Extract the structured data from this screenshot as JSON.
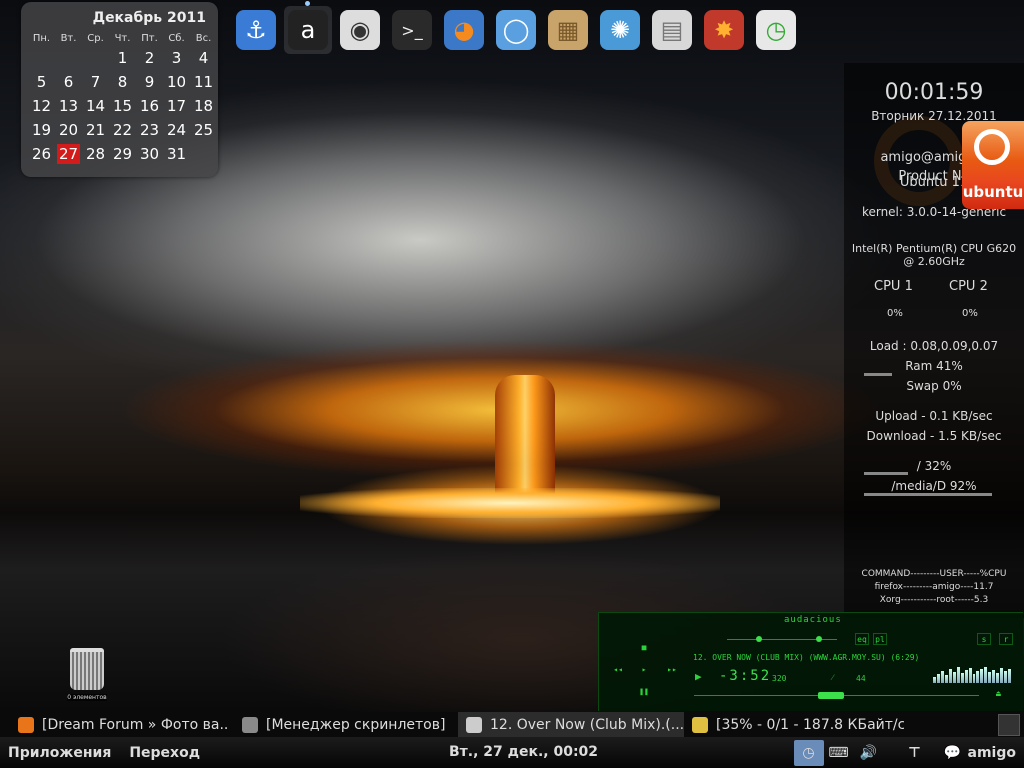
{
  "calendar": {
    "title": "Декабрь 2011",
    "weekdays": [
      "Пн.",
      "Вт.",
      "Ср.",
      "Чт.",
      "Пт.",
      "Сб.",
      "Вс."
    ],
    "weeks": [
      [
        "",
        "",
        "",
        "1",
        "2",
        "3",
        "4"
      ],
      [
        "5",
        "6",
        "7",
        "8",
        "9",
        "10",
        "11"
      ],
      [
        "12",
        "13",
        "14",
        "15",
        "16",
        "17",
        "18"
      ],
      [
        "19",
        "20",
        "21",
        "22",
        "23",
        "24",
        "25"
      ],
      [
        "26",
        "27",
        "28",
        "29",
        "30",
        "31",
        ""
      ]
    ],
    "today": "27",
    "today_color": "#d31b1b"
  },
  "dock": {
    "items": [
      {
        "name": "anchor-icon",
        "glyph": "⚓",
        "bg": "#3a7bd5",
        "fg": "#fff"
      },
      {
        "name": "avant-icon",
        "glyph": "a",
        "bg": "#222",
        "fg": "#fff",
        "active": true
      },
      {
        "name": "camera-icon",
        "glyph": "◉",
        "bg": "#ddd",
        "fg": "#333"
      },
      {
        "name": "terminal-icon",
        "glyph": ">_",
        "bg": "#2a2a2a",
        "fg": "#eee"
      },
      {
        "name": "firefox-icon",
        "glyph": "◕",
        "bg": "#3b78c8",
        "fg": "#f58a1f"
      },
      {
        "name": "chromium-icon",
        "glyph": "◯",
        "bg": "#5aa0e0",
        "fg": "#fff"
      },
      {
        "name": "package-icon",
        "glyph": "▦",
        "bg": "#c9a46a",
        "fg": "#7a5a2a"
      },
      {
        "name": "shutter-icon",
        "glyph": "✺",
        "bg": "#4a9ad8",
        "fg": "#fff"
      },
      {
        "name": "file-cabinet-icon",
        "glyph": "▤",
        "bg": "#d8d8d8",
        "fg": "#777"
      },
      {
        "name": "burner-icon",
        "glyph": "✸",
        "bg": "#c0392b",
        "fg": "#ffb030"
      },
      {
        "name": "screenlets-manager-icon",
        "glyph": "◷",
        "bg": "#e8e8e8",
        "fg": "#3a3"
      }
    ]
  },
  "sysinfo": {
    "time": "00:01:59",
    "date": "Вторник 27.12.2011",
    "user": "amigo@amigo-S",
    "product": "Product Na",
    "os": "Ubuntu 11",
    "kernel": "kernel: 3.0.0-14-generic",
    "cpu_model": "Intel(R) Pentium(R) CPU G620 @ 2.60GHz",
    "cpu1_label": "CPU 1",
    "cpu2_label": "CPU 2",
    "cpu1_value": "0%",
    "cpu2_value": "0%",
    "load": "Load : 0.08,0.09,0.07",
    "ram": "Ram 41%",
    "swap": "Swap 0%",
    "upload": "Upload - 0.1 KB/sec",
    "download": "Download - 1.5 KB/sec",
    "disk_root": "/ 32%",
    "disk_media": "/media/D 92%",
    "ubuntu_badge": "ubuntu",
    "processes_header": "COMMAND---------USER-----%CPU",
    "processes": [
      "firefox---------amigo----11.7",
      "Xorg-----------root------5.3"
    ]
  },
  "player": {
    "logo": "audacious",
    "track": "12. OVER NOW (CLUB MIX) (WWW.AGR.MOY.SU) (6:29)",
    "time": "-3:52",
    "kbps": "320",
    "khz": "44",
    "spectrum": [
      6,
      9,
      12,
      8,
      14,
      11,
      16,
      10,
      13,
      15,
      9,
      12,
      14,
      16,
      11,
      13,
      10,
      15,
      12,
      14
    ],
    "accent": "#2bd33a"
  },
  "trash": {
    "label": "0 элементов"
  },
  "taskbar": {
    "tasks": [
      {
        "label": "[Dream Forum » Фото ва...",
        "color": "#e8751a"
      },
      {
        "label": "[Менеджер скринлетов]",
        "color": "#8a8a8a"
      },
      {
        "label": "12. Over Now (Club Mix).(...",
        "color": "#cccccc",
        "active": true
      },
      {
        "label": "[35% - 0/1 - 187.8 КБайт/с...",
        "color": "#e0c040"
      }
    ]
  },
  "panel": {
    "applications": "Приложения",
    "places": "Переход",
    "clock": "Вт., 27 дек., 00:02",
    "user": "amigo"
  }
}
